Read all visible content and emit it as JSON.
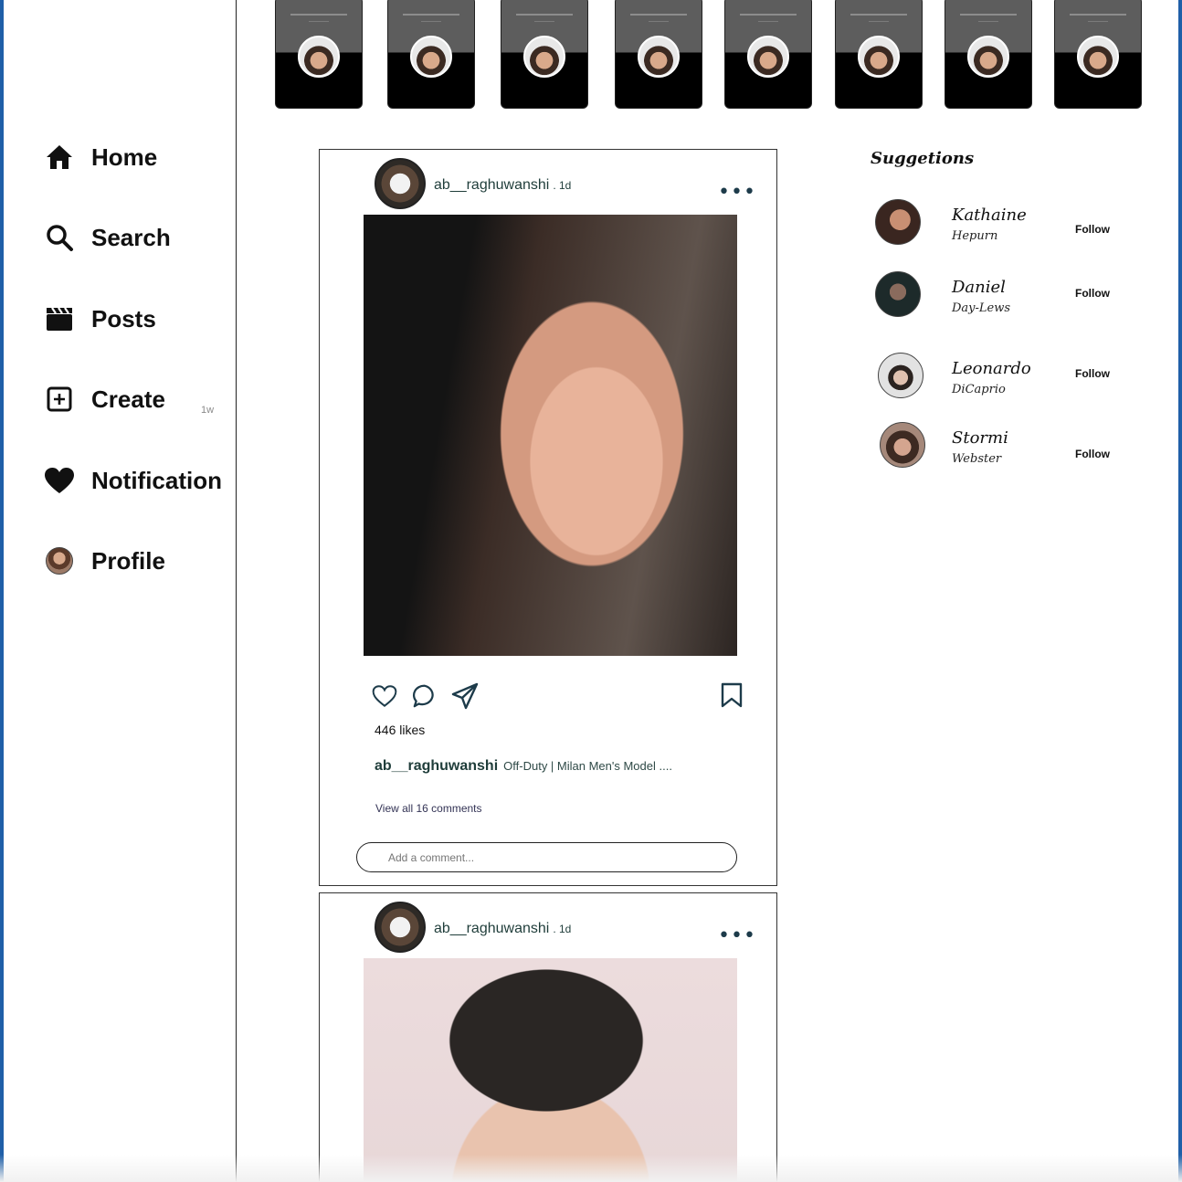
{
  "nav": {
    "items": [
      {
        "label": "Home",
        "icon": "home-icon"
      },
      {
        "label": "Search",
        "icon": "search-icon"
      },
      {
        "label": "Posts",
        "icon": "clapperboard-icon"
      },
      {
        "label": "Create",
        "icon": "plus-square-icon"
      },
      {
        "label": "Notification",
        "icon": "heart-icon"
      },
      {
        "label": "Profile",
        "icon": "avatar"
      }
    ],
    "badge": "1w"
  },
  "stories": {
    "count": 8
  },
  "posts": [
    {
      "username": "ab__raghuwanshi",
      "time": ". 1d",
      "likes": "446 likes",
      "caption_user": "ab__raghuwanshi",
      "caption_text": "Off-Duty | Milan Men's Model ....",
      "view_comments": "View all 16 comments",
      "comment_placeholder": "Add a comment..."
    },
    {
      "username": "ab__raghuwanshi",
      "time": ". 1d"
    }
  ],
  "suggestions": {
    "title": "Suggetions",
    "follow_label": "Follow",
    "people": [
      {
        "first": "Kathaine",
        "last": "Hepurn"
      },
      {
        "first": "Daniel",
        "last": "Day-Lews"
      },
      {
        "first": "Leonardo",
        "last": "DiCaprio"
      },
      {
        "first": "Stormi",
        "last": "Webster"
      }
    ]
  },
  "colors": {
    "frame": "#1f5fa8",
    "text_dark": "#1f3d3a"
  }
}
